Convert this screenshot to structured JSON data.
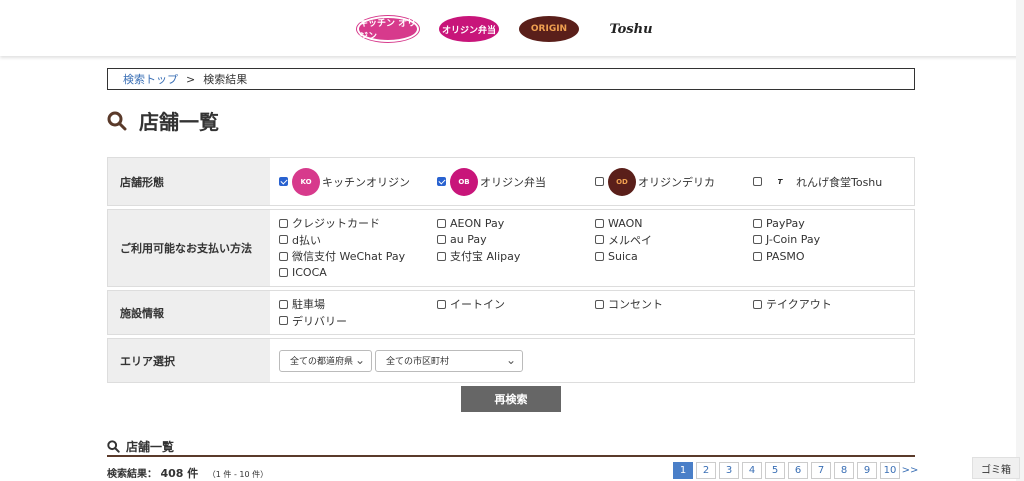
{
  "header": {
    "logos": [
      {
        "text": "キッチン オリジン",
        "name": "kitchen-origin-logo"
      },
      {
        "text": "オリジン弁当",
        "name": "origin-bento-logo"
      },
      {
        "text": "ORIGIN",
        "name": "origin-delica-logo"
      },
      {
        "text": "Toshu",
        "name": "toshu-logo"
      }
    ]
  },
  "breadcrumb": {
    "home": "検索トップ",
    "separator": ">",
    "current": "検索結果"
  },
  "page_title": "店舗一覧",
  "form": {
    "store_type": {
      "label": "店舗形態",
      "options": [
        {
          "label": "キッチンオリジン",
          "checked": true
        },
        {
          "label": "オリジン弁当",
          "checked": true
        },
        {
          "label": "オリジンデリカ",
          "checked": false
        },
        {
          "label": "れんげ食堂Toshu",
          "checked": false
        }
      ]
    },
    "payment": {
      "label": "ご利用可能なお支払い方法",
      "options": [
        "クレジットカード",
        "AEON Pay",
        "WAON",
        "PayPay",
        "d払い",
        "au Pay",
        "メルペイ",
        "J-Coin Pay",
        "微信支付 WeChat Pay",
        "支付宝 Alipay",
        "Suica",
        "PASMO",
        "ICOCA"
      ]
    },
    "facility": {
      "label": "施設情報",
      "options": [
        "駐車場",
        "イートイン",
        "コンセント",
        "テイクアウト",
        "デリバリー"
      ]
    },
    "area": {
      "label": "エリア選択",
      "prefecture": "全ての都道府県",
      "city": "全ての市区町村"
    }
  },
  "search_button": "再検索",
  "results": {
    "title": "店舗一覧",
    "label": "検索結果：",
    "count": "408 件",
    "range": "（1 件 - 10 件）",
    "pages": [
      "1",
      "2",
      "3",
      "4",
      "5",
      "6",
      "7",
      "8",
      "9",
      "10"
    ],
    "next": ">>"
  },
  "trash_button": "ゴミ箱"
}
